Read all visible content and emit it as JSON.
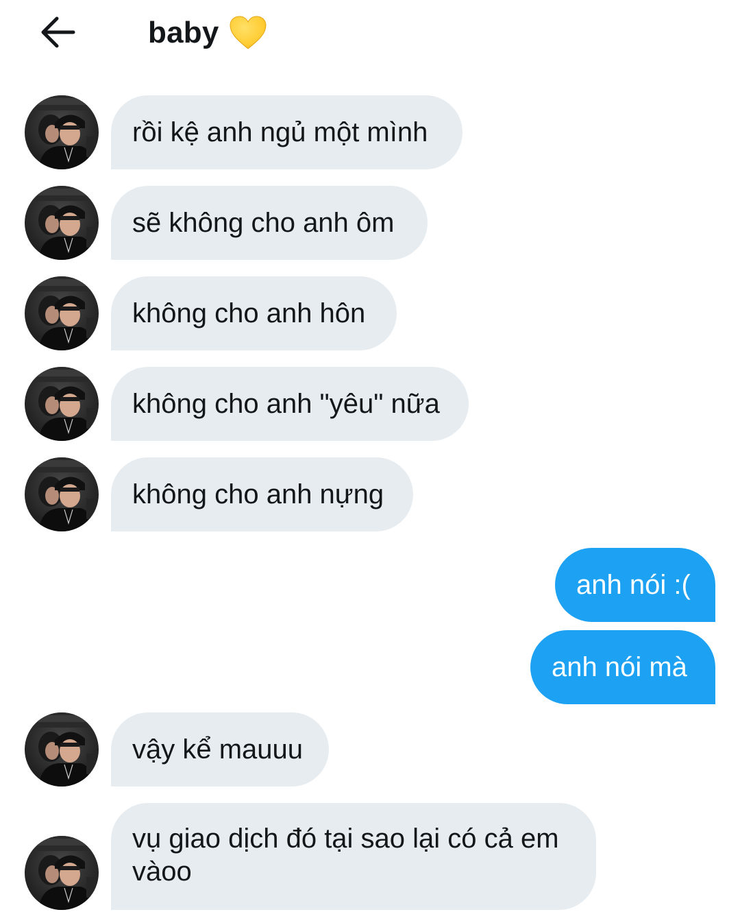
{
  "header": {
    "back_icon": "arrow-left-icon",
    "title": "baby",
    "title_emoji": "yellow-heart-icon",
    "heart_color": "#ffcc33"
  },
  "colors": {
    "incoming_bubble": "#e6ecf0",
    "outgoing_bubble": "#1da1f2",
    "text_dark": "#14171a",
    "text_light": "#ffffff"
  },
  "messages": [
    {
      "direction": "incoming",
      "text": "rồi kệ anh ngủ một mình"
    },
    {
      "direction": "incoming",
      "text": "sẽ không cho anh ôm"
    },
    {
      "direction": "incoming",
      "text": "không cho anh hôn"
    },
    {
      "direction": "incoming",
      "text": "không cho anh \"yêu\" nữa"
    },
    {
      "direction": "incoming",
      "text": "không cho anh nựng"
    },
    {
      "direction": "outgoing",
      "text": "anh nói :("
    },
    {
      "direction": "outgoing",
      "text": "anh nói mà"
    },
    {
      "direction": "incoming",
      "text": "vậy kể mauuu"
    },
    {
      "direction": "incoming",
      "text": "vụ giao dịch đó tại sao lại có cả em vàoo"
    }
  ]
}
